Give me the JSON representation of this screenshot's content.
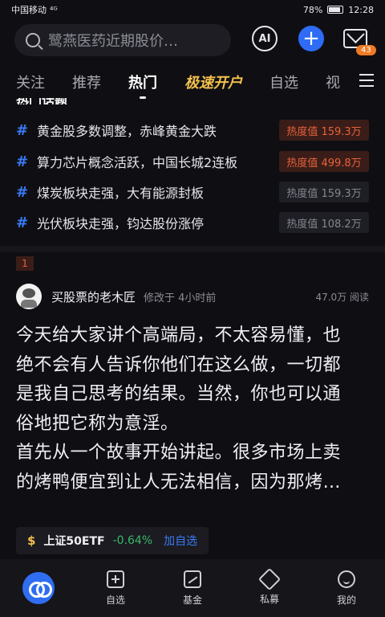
{
  "status_bar": {
    "carrier": "中国移动",
    "signal": "⁴ᴳ",
    "battery": "78%",
    "time": "12:28"
  },
  "header": {
    "search_placeholder": "鹭燕医药近期股价…",
    "ai_label": "AI",
    "add_label": "+",
    "mail_badge": "43"
  },
  "tabs": [
    {
      "label": "关注"
    },
    {
      "label": "推荐"
    },
    {
      "label": "热门"
    },
    {
      "label": "极速开户"
    },
    {
      "label": "自选"
    },
    {
      "label": "视"
    }
  ],
  "hot_section": {
    "title": "热门话题",
    "hash": "#",
    "topics": [
      {
        "text": "黄金股多数调整，赤峰黄金大跌",
        "heat": "热度值 159.3万",
        "hot": true
      },
      {
        "text": "算力芯片概念活跃，中国长城2连板",
        "heat": "热度值 499.8万",
        "hot": true
      },
      {
        "text": "煤炭板块走强，大有能源封板",
        "heat": "热度值 159.3万",
        "hot": false
      },
      {
        "text": "光伏板块走强，钧达股份涨停",
        "heat": "热度值 108.2万",
        "hot": false
      }
    ]
  },
  "post": {
    "rank": "1",
    "author": "买股票的老木匠",
    "modified": "修改于 4小时前",
    "reads": "47.0万 阅读",
    "lines": [
      "今天给大家讲个高端局，不太容易懂，也",
      "绝不会有人告诉你他们在这么做，一切都",
      "是我自己思考的结果。当然，你也可以通",
      "俗地把它称为意淫。",
      "首先从一个故事开始讲起。很多市场上卖",
      "的烤鸭便宜到让人无法相信，因为那烤…"
    ],
    "stock": {
      "icon": "$",
      "name": "上证50ETF",
      "change": "-0.64%",
      "action": "加自选"
    }
  },
  "bottom_nav": [
    {
      "label": ""
    },
    {
      "label": "自选"
    },
    {
      "label": "基金"
    },
    {
      "label": "私募"
    },
    {
      "label": "我的"
    }
  ]
}
